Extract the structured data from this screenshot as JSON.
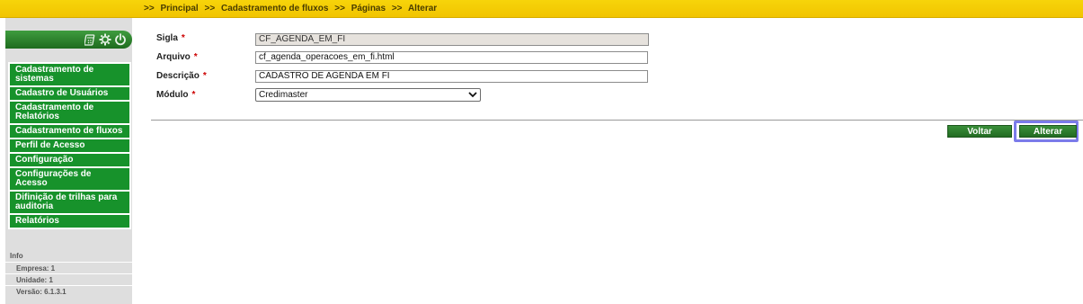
{
  "breadcrumb": {
    "sep1": ">>",
    "item1": "Principal",
    "sep2": ">>",
    "item2": "Cadastramento de fluxos",
    "sep3": ">>",
    "item3": "Páginas",
    "sep4": ">>",
    "item4": "Alterar"
  },
  "sidebar": {
    "header_icons": [
      "calculator-icon",
      "gear-icon",
      "power-icon"
    ],
    "menu": [
      {
        "label": "Cadastramento de sistemas"
      },
      {
        "label": "Cadastro de Usuários"
      },
      {
        "label": "Cadastramento de Relatórios"
      },
      {
        "label": "Cadastramento de fluxos"
      },
      {
        "label": "Perfil de Acesso"
      },
      {
        "label": "Configuração"
      },
      {
        "label": "Configurações de Acesso"
      },
      {
        "label": "Difinição de trilhas para auditoria"
      },
      {
        "label": "Relatórios"
      }
    ],
    "info": {
      "title": "Info",
      "empresa": "Empresa: 1",
      "unidade": "Unidade: 1",
      "versao": "Versão: 6.1.3.1"
    }
  },
  "form": {
    "sigla": {
      "label": "Sigla",
      "required": "*",
      "value": "CF_AGENDA_EM_FI"
    },
    "arquivo": {
      "label": "Arquivo",
      "required": "*",
      "value": "cf_agenda_operacoes_em_fi.html"
    },
    "descricao": {
      "label": "Descrição",
      "required": "*",
      "value": "CADASTRO DE AGENDA EM FI"
    },
    "modulo": {
      "label": "Módulo",
      "required": "*",
      "selected": "Credimaster"
    }
  },
  "actions": {
    "voltar": "Voltar",
    "alterar": "Alterar"
  },
  "colors": {
    "topbar": "#f1c400",
    "menu_green": "#17922b",
    "button_green": "#2e7d2e",
    "focus_ring": "#7b7bea"
  }
}
